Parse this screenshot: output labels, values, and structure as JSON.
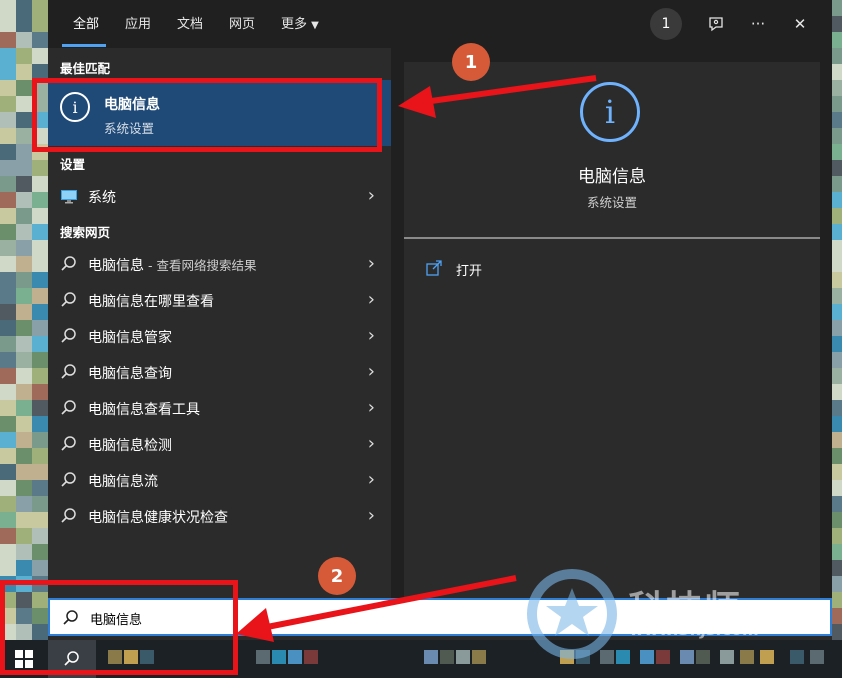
{
  "tabs": [
    "全部",
    "应用",
    "文档",
    "网页",
    "更多"
  ],
  "top_buttons": {
    "badge": "1",
    "more": "···",
    "close": "✕"
  },
  "sections": {
    "best_match": "最佳匹配",
    "settings": "设置",
    "web": "搜索网页"
  },
  "best_match": {
    "title": "电脑信息",
    "subtitle": "系统设置"
  },
  "settings_item": {
    "label": "系统"
  },
  "web_items": [
    {
      "label": "电脑信息",
      "sub": " - 查看网络搜索结果"
    },
    {
      "label": "电脑信息在哪里查看"
    },
    {
      "label": "电脑信息管家"
    },
    {
      "label": "电脑信息查询"
    },
    {
      "label": "电脑信息查看工具"
    },
    {
      "label": "电脑信息检测"
    },
    {
      "label": "电脑信息流"
    },
    {
      "label": "电脑信息健康状况检查"
    }
  ],
  "detail": {
    "title": "电脑信息",
    "subtitle": "系统设置",
    "action_open": "打开"
  },
  "search": {
    "value": "电脑信息"
  },
  "annotations": {
    "step1": "1",
    "step2": "2"
  },
  "watermark": {
    "text": "科技师",
    "url": "www.3kjs.com"
  },
  "colors": {
    "accent": "#4ea1f3",
    "highlight": "#1f4a78",
    "annotation_red": "#e8141a"
  }
}
